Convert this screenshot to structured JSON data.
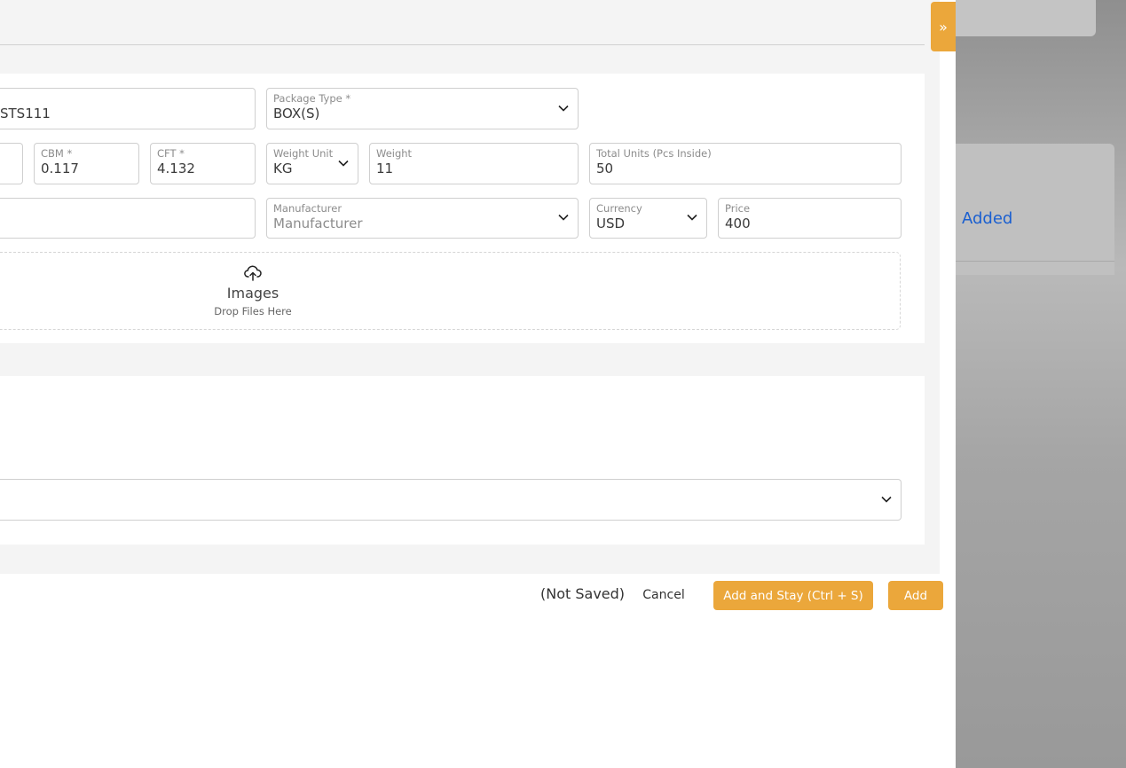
{
  "background": {
    "card_text": "Added"
  },
  "drawer": {
    "toggle_icon": "»",
    "fields": {
      "code": {
        "value": "STS111"
      },
      "package_type": {
        "label": "Package Type *",
        "value": "BOX(S)"
      },
      "cbm": {
        "label": "CBM *",
        "value": "0.117"
      },
      "cft": {
        "label": "CFT *",
        "value": "4.132"
      },
      "weight_unit": {
        "label": "Weight Unit",
        "value": "KG"
      },
      "weight": {
        "label": "Weight",
        "value": "11"
      },
      "total_units": {
        "label": "Total Units (Pcs Inside)",
        "value": "50"
      },
      "manufacturer": {
        "label": "Manufacturer",
        "placeholder": "Manufacturer"
      },
      "currency": {
        "label": "Currency",
        "value": "USD"
      },
      "price": {
        "label": "Price",
        "value": "400"
      }
    },
    "dropzone": {
      "title": "Images",
      "subtitle": "Drop Files Here",
      "icon": "cloud-upload-icon"
    }
  },
  "footer": {
    "status": "(Not Saved)",
    "cancel_label": "Cancel",
    "add_stay_label": "Add and Stay (Ctrl + S)",
    "add_label": "Add"
  },
  "colors": {
    "accent": "#eba73b",
    "link": "#1a5fd0"
  }
}
